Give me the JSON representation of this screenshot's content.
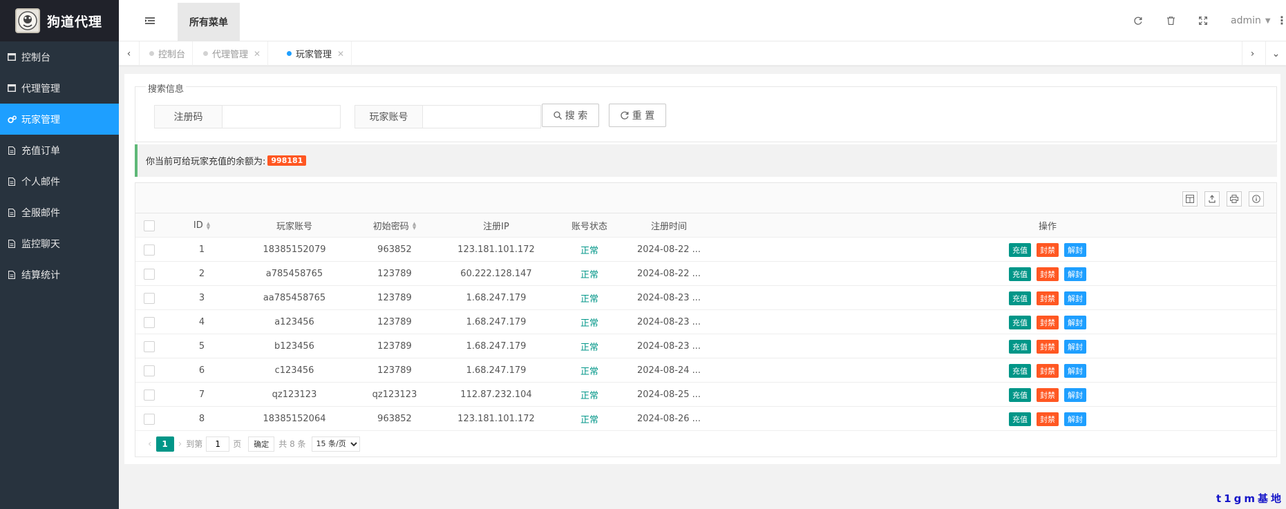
{
  "app": {
    "title": "狗道代理"
  },
  "sidebar": {
    "items": [
      {
        "label": "控制台",
        "icon": "window-icon"
      },
      {
        "label": "代理管理",
        "icon": "window-icon"
      },
      {
        "label": "玩家管理",
        "icon": "gears-icon",
        "active": true
      },
      {
        "label": "充值订单",
        "icon": "file-icon"
      },
      {
        "label": "个人邮件",
        "icon": "file-icon"
      },
      {
        "label": "全服邮件",
        "icon": "file-icon"
      },
      {
        "label": "监控聊天",
        "icon": "file-icon"
      },
      {
        "label": "结算统计",
        "icon": "file-icon"
      }
    ]
  },
  "header": {
    "all_menu": "所有菜单",
    "user": "admin"
  },
  "tabs": [
    {
      "label": "控制台",
      "closable": false
    },
    {
      "label": "代理管理",
      "closable": true
    },
    {
      "label": "玩家管理",
      "closable": true,
      "active": true
    }
  ],
  "search": {
    "legend": "搜索信息",
    "reg_code_label": "注册码",
    "reg_code_value": "",
    "account_label": "玩家账号",
    "account_value": "",
    "search_btn": "搜 索",
    "reset_btn": "重 置"
  },
  "notice": {
    "text": "你当前可给玩家充值的余额为:",
    "balance": "998181"
  },
  "table": {
    "columns": [
      "ID",
      "玩家账号",
      "初始密码",
      "注册IP",
      "账号状态",
      "注册时间",
      "操作"
    ],
    "actions": [
      "充值",
      "封禁",
      "解封"
    ],
    "rows": [
      {
        "id": "1",
        "account": "18385152079",
        "password": "963852",
        "ip": "123.181.101.172",
        "status": "正常",
        "time": "2024-08-22 ..."
      },
      {
        "id": "2",
        "account": "a785458765",
        "password": "123789",
        "ip": "60.222.128.147",
        "status": "正常",
        "time": "2024-08-22 ..."
      },
      {
        "id": "3",
        "account": "aa785458765",
        "password": "123789",
        "ip": "1.68.247.179",
        "status": "正常",
        "time": "2024-08-23 ..."
      },
      {
        "id": "4",
        "account": "a123456",
        "password": "123789",
        "ip": "1.68.247.179",
        "status": "正常",
        "time": "2024-08-23 ..."
      },
      {
        "id": "5",
        "account": "b123456",
        "password": "123789",
        "ip": "1.68.247.179",
        "status": "正常",
        "time": "2024-08-23 ..."
      },
      {
        "id": "6",
        "account": "c123456",
        "password": "123789",
        "ip": "1.68.247.179",
        "status": "正常",
        "time": "2024-08-24 ..."
      },
      {
        "id": "7",
        "account": "qz123123",
        "password": "qz123123",
        "ip": "112.87.232.104",
        "status": "正常",
        "time": "2024-08-25 ..."
      },
      {
        "id": "8",
        "account": "18385152064",
        "password": "963852",
        "ip": "123.181.101.172",
        "status": "正常",
        "time": "2024-08-26 ..."
      }
    ]
  },
  "pager": {
    "current": "1",
    "goto_label": "到第",
    "goto_value": "1",
    "page_unit": "页",
    "confirm": "确定",
    "total": "共 8 条",
    "page_size": "15 条/页"
  },
  "watermark": "t1gm基地",
  "colors": {
    "sidebar_bg": "#28333e",
    "logo_bg": "#20222a",
    "active_blue": "#1e9fff",
    "green": "#009688",
    "orange": "#ff5722",
    "notice_border": "#5fb878"
  }
}
